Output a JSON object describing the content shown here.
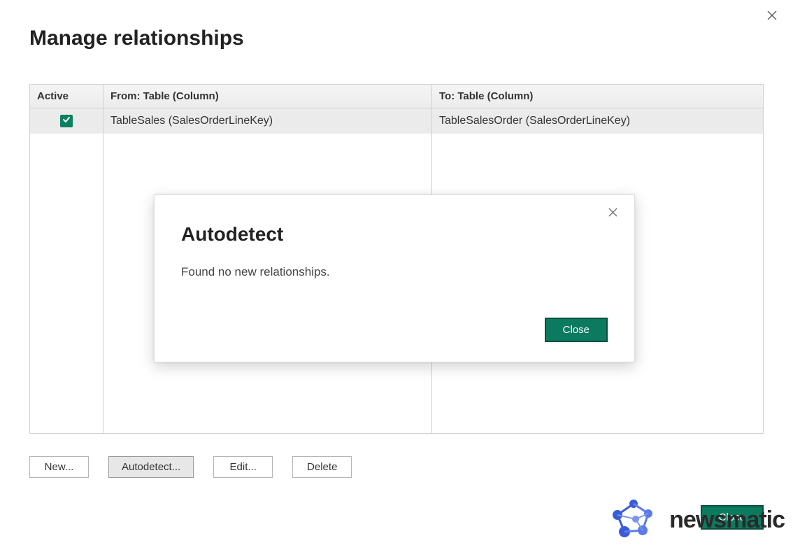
{
  "dialog": {
    "title": "Manage relationships",
    "close_icon": "close"
  },
  "table": {
    "headers": {
      "active": "Active",
      "from": "From: Table (Column)",
      "to": "To: Table (Column)"
    },
    "rows": [
      {
        "active": true,
        "from": "TableSales (SalesOrderLineKey)",
        "to": "TableSalesOrder (SalesOrderLineKey)"
      }
    ]
  },
  "buttons": {
    "new": "New...",
    "autodetect": "Autodetect...",
    "edit": "Edit...",
    "delete": "Delete",
    "close_main": "Close"
  },
  "modal": {
    "title": "Autodetect",
    "message": "Found no new relationships.",
    "close_button": "Close"
  },
  "watermark": {
    "text": "newsmatic"
  },
  "colors": {
    "primary": "#0c7a5f",
    "checkbox": "#0c8061"
  }
}
